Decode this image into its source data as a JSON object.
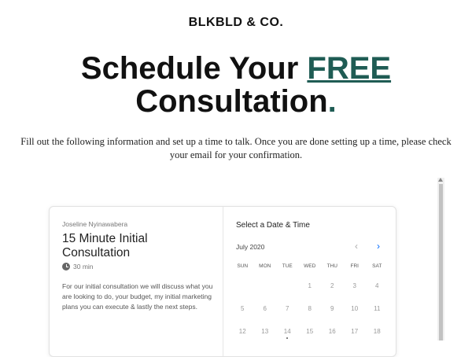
{
  "brand": "BLKBLD & CO.",
  "headline": {
    "line1_prefix": "Schedule Your ",
    "line1_accent": "FREE ",
    "line2": "Consultation",
    "line2_dot": "."
  },
  "intro": "Fill out the following information and set up a time to talk. Once you are done setting up a time, please check your email for your confirmation.",
  "event": {
    "organizer": "Joseline Nyinawabera",
    "title": "15 Minute Initial Consultation",
    "duration": "30 min",
    "description": "For our initial consultation we will discuss what you are looking to do, your budget, my initial marketing plans you can execute & lastly the next steps."
  },
  "calendar": {
    "heading": "Select a Date & Time",
    "month": "July 2020",
    "prev_icon": "chevron-left-icon",
    "next_icon": "chevron-right-icon",
    "weekdays": [
      "SUN",
      "MON",
      "TUE",
      "WED",
      "THU",
      "FRI",
      "SAT"
    ],
    "weeks": [
      [
        "",
        "",
        "",
        "1",
        "2",
        "3",
        "4"
      ],
      [
        "5",
        "6",
        "7",
        "8",
        "9",
        "10",
        "11"
      ],
      [
        "12",
        "13",
        "14",
        "15",
        "16",
        "17",
        "18"
      ]
    ]
  },
  "colors": {
    "accent": "#1f5c54",
    "link_blue": "#0069ff"
  }
}
